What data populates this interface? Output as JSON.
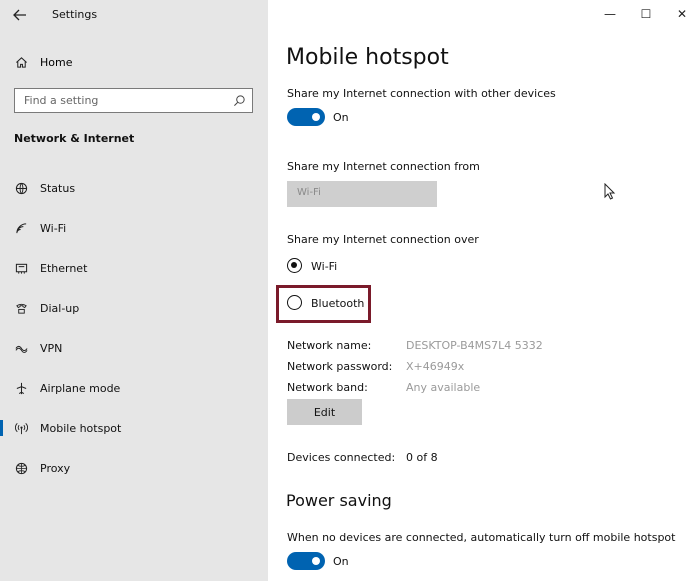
{
  "window": {
    "title": "Settings",
    "controls": {
      "minimize": "—",
      "maximize": "☐",
      "close": "✕"
    }
  },
  "sidebar": {
    "home_label": "Home",
    "search_placeholder": "Find a setting",
    "section_title": "Network & Internet",
    "items": [
      {
        "label": "Status",
        "icon": "status-icon"
      },
      {
        "label": "Wi-Fi",
        "icon": "wifi-icon"
      },
      {
        "label": "Ethernet",
        "icon": "ethernet-icon"
      },
      {
        "label": "Dial-up",
        "icon": "dialup-icon"
      },
      {
        "label": "VPN",
        "icon": "vpn-icon"
      },
      {
        "label": "Airplane mode",
        "icon": "airplane-icon"
      },
      {
        "label": "Mobile hotspot",
        "icon": "hotspot-icon",
        "selected": true
      },
      {
        "label": "Proxy",
        "icon": "proxy-icon"
      }
    ]
  },
  "main": {
    "title": "Mobile hotspot",
    "share_label": "Share my Internet connection with other devices",
    "share_toggle": "On",
    "share_from_label": "Share my Internet connection from",
    "share_from_value": "Wi-Fi",
    "share_over_label": "Share my Internet connection over",
    "options": [
      {
        "label": "Wi-Fi",
        "checked": true
      },
      {
        "label": "Bluetooth",
        "checked": false
      }
    ],
    "info": {
      "name_label": "Network name:",
      "name_value": "DESKTOP-B4MS7L4 5332",
      "password_label": "Network password:",
      "password_value": "X+46949x",
      "band_label": "Network band:",
      "band_value": "Any available"
    },
    "edit_label": "Edit",
    "devices_label": "Devices connected:",
    "devices_value": "0 of 8",
    "power_title": "Power saving",
    "power_label": "When no devices are connected, automatically turn off mobile hotspot",
    "power_toggle": "On"
  },
  "colors": {
    "accent": "#0063b1",
    "highlight": "#7a1a2a",
    "sidebar_bg": "#e6e6e6"
  }
}
